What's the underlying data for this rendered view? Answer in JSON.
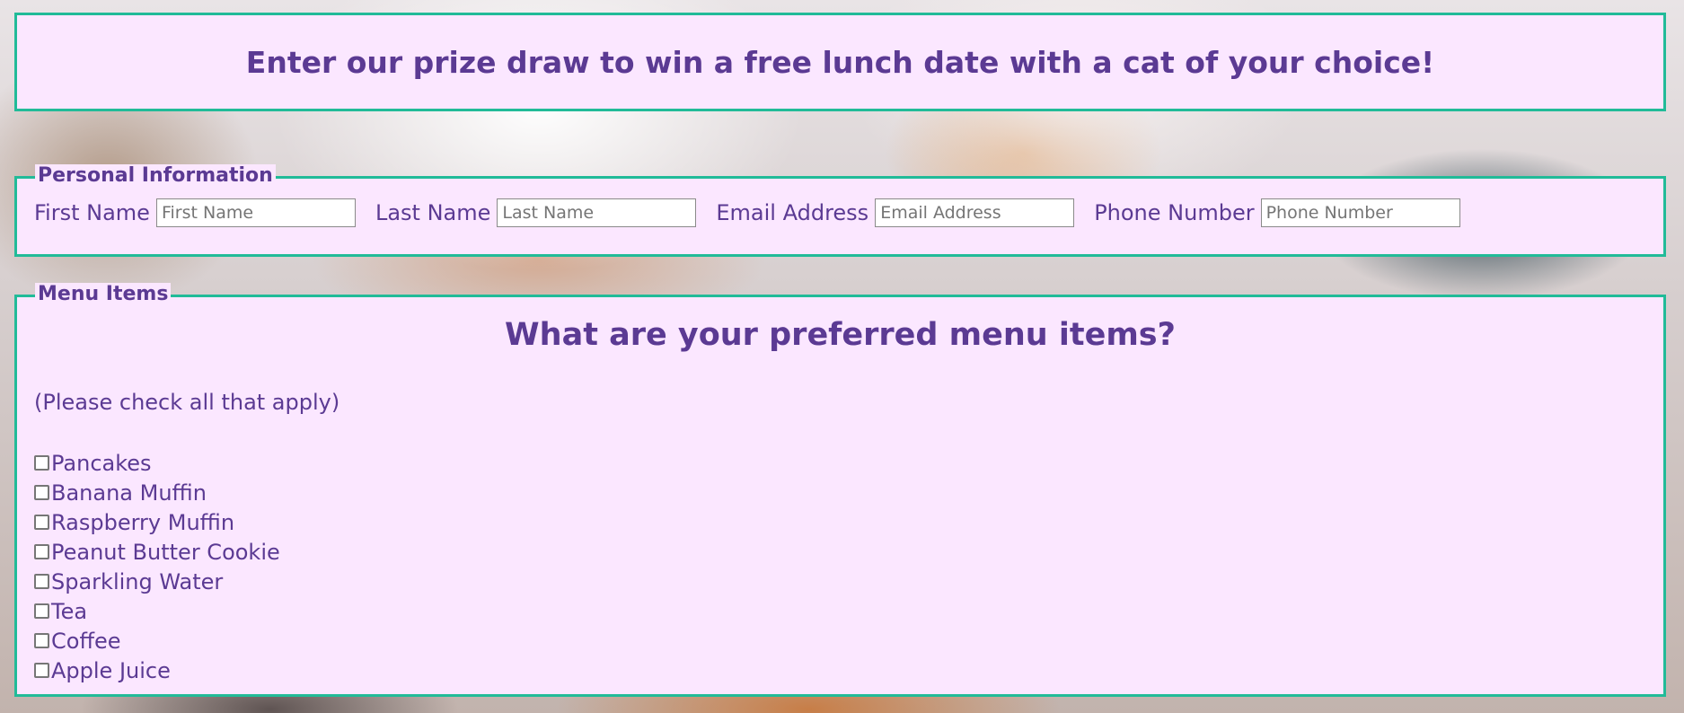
{
  "banner": {
    "title": "Enter our prize draw to win a free lunch date with a cat of your choice!"
  },
  "personal": {
    "legend": "Personal Information",
    "fields": [
      {
        "label": "First Name",
        "placeholder": "First Name",
        "value": ""
      },
      {
        "label": "Last Name",
        "placeholder": "Last Name",
        "value": ""
      },
      {
        "label": "Email Address",
        "placeholder": "Email Address",
        "value": ""
      },
      {
        "label": "Phone Number",
        "placeholder": "Phone Number",
        "value": ""
      }
    ]
  },
  "menu": {
    "legend": "Menu Items",
    "heading": "What are your preferred menu items?",
    "hint": "(Please check all that apply)",
    "items": [
      {
        "label": "Pancakes",
        "checked": false
      },
      {
        "label": "Banana Muffin",
        "checked": false
      },
      {
        "label": "Raspberry Muffin",
        "checked": false
      },
      {
        "label": "Peanut Butter Cookie",
        "checked": false
      },
      {
        "label": "Sparkling Water",
        "checked": false
      },
      {
        "label": "Tea",
        "checked": false
      },
      {
        "label": "Coffee",
        "checked": false
      },
      {
        "label": "Apple Juice",
        "checked": false
      }
    ]
  },
  "colors": {
    "panel_background": "#fbe7ff",
    "panel_border": "#21bb98",
    "text": "#5b3a93"
  }
}
